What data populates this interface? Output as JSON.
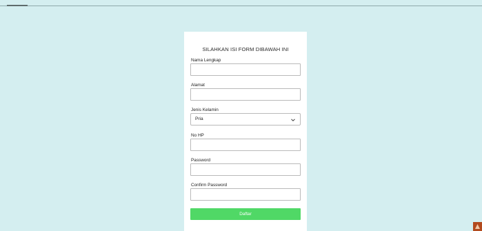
{
  "form": {
    "title": "SILAHKAN ISI FORM DIBAWAH INI",
    "fields": [
      {
        "label": "Nama Lengkap",
        "value": ""
      },
      {
        "label": "Alamat",
        "value": ""
      },
      {
        "label": "Jenis Kelamin",
        "selected": "Pria"
      },
      {
        "label": "No HP",
        "value": ""
      },
      {
        "label": "Password",
        "value": ""
      },
      {
        "label": "Confirm Password",
        "value": ""
      }
    ],
    "submit_label": "Daftar"
  },
  "icons": {
    "select_chevron": "chevron-down-icon",
    "corner": "app-icon"
  },
  "colors": {
    "page_background": "#d4eef0",
    "card_background": "#ffffff",
    "button_background": "#50d866",
    "button_text": "#ffffff",
    "input_border": "#b9b9b9",
    "corner_icon": "#b24a1e"
  }
}
